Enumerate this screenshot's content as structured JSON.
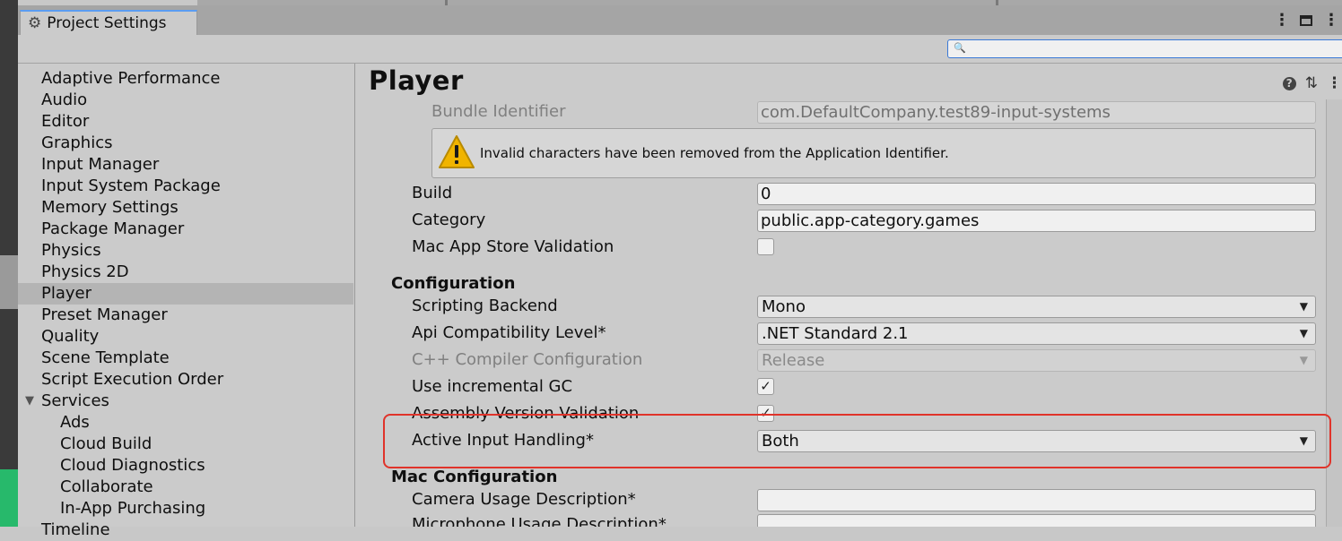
{
  "window": {
    "tab_title": "Project Settings",
    "tab_icon": "gear-icon"
  },
  "search": {
    "placeholder": "",
    "value": ""
  },
  "sidebar": {
    "items": [
      {
        "label": "Adaptive Performance"
      },
      {
        "label": "Audio"
      },
      {
        "label": "Editor"
      },
      {
        "label": "Graphics"
      },
      {
        "label": "Input Manager"
      },
      {
        "label": "Input System Package"
      },
      {
        "label": "Memory Settings"
      },
      {
        "label": "Package Manager"
      },
      {
        "label": "Physics"
      },
      {
        "label": "Physics 2D"
      },
      {
        "label": "Player",
        "selected": true
      },
      {
        "label": "Preset Manager"
      },
      {
        "label": "Quality"
      },
      {
        "label": "Scene Template"
      },
      {
        "label": "Script Execution Order"
      },
      {
        "label": "Services",
        "expanded": true
      },
      {
        "label": "Ads"
      },
      {
        "label": "Cloud Build"
      },
      {
        "label": "Cloud Diagnostics"
      },
      {
        "label": "Collaborate"
      },
      {
        "label": "In-App Purchasing"
      },
      {
        "label": "Timeline"
      }
    ]
  },
  "main": {
    "title": "Player",
    "bundle_identifier": {
      "label": "Bundle Identifier",
      "value": "com.DefaultCompany.test89-input-systems"
    },
    "warning": {
      "text": "Invalid characters have been removed from the Application Identifier."
    },
    "build": {
      "label": "Build",
      "value": "0"
    },
    "category": {
      "label": "Category",
      "value": "public.app-category.games"
    },
    "mac_app_store_validation": {
      "label": "Mac App Store Validation",
      "checked": false
    },
    "configuration": {
      "heading": "Configuration",
      "scripting_backend": {
        "label": "Scripting Backend",
        "value": "Mono"
      },
      "api_compatibility": {
        "label": "Api Compatibility Level*",
        "value": ".NET Standard 2.1"
      },
      "cpp_compiler": {
        "label": "C++ Compiler Configuration",
        "value": "Release",
        "disabled": true
      },
      "incremental_gc": {
        "label": "Use incremental GC",
        "checked": true,
        "mark": "✓"
      },
      "assembly_validation": {
        "label": "Assembly Version Validation",
        "checked": true,
        "mark": "✓"
      },
      "active_input": {
        "label": "Active Input Handling*",
        "value": "Both"
      }
    },
    "mac_configuration": {
      "heading": "Mac Configuration",
      "camera_usage": {
        "label": "Camera Usage Description*",
        "value": ""
      },
      "microphone_usage": {
        "label": "Microphone Usage Description*",
        "value": ""
      }
    }
  },
  "colors": {
    "highlight": "#e0332a",
    "selected_row": "#b4b4b4",
    "accent": "#3a79d7"
  }
}
